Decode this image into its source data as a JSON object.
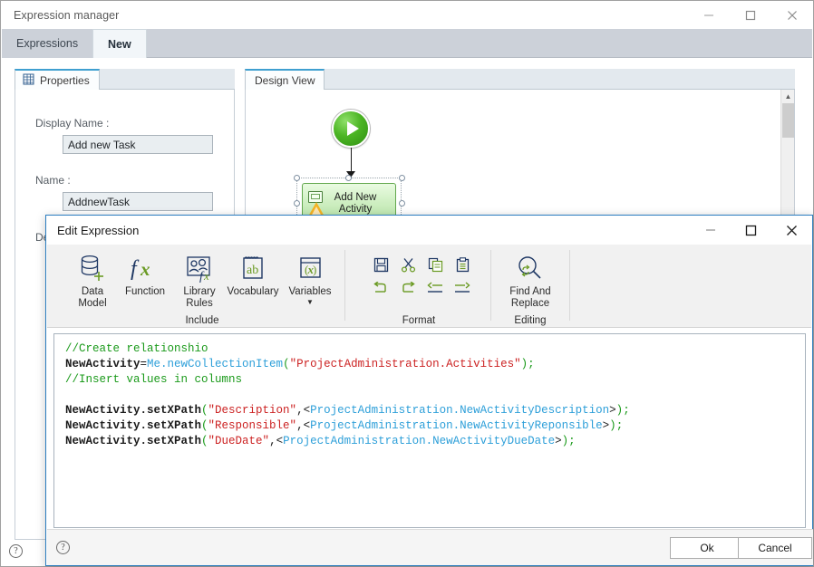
{
  "main_window": {
    "title": "Expression manager",
    "controls": [
      {
        "name": "minimize",
        "glyph": "minimize-icon"
      },
      {
        "name": "maximize",
        "glyph": "maximize-icon"
      },
      {
        "name": "close",
        "glyph": "close-icon"
      }
    ],
    "tabs": [
      {
        "label": "Expressions",
        "active": false
      },
      {
        "label": "New",
        "active": true
      }
    ],
    "help_icon": "help-icon"
  },
  "properties_panel": {
    "tab_label": "Properties",
    "tab_icon": "properties-grid-icon",
    "fields": [
      {
        "label": "Display Name :",
        "value": "Add new Task"
      },
      {
        "label": "Name :",
        "value": "AddnewTask"
      },
      {
        "label": "Des",
        "value": ""
      }
    ]
  },
  "design_panel": {
    "tab_label": "Design View",
    "nodes": [
      {
        "type": "start",
        "icon": "play-start-icon",
        "label": ""
      },
      {
        "type": "activity",
        "label": "Add New\nActivity",
        "icons": [
          "monitor-icon",
          "warning-icon"
        ],
        "selected": true
      }
    ],
    "scrollbar": {
      "up_arrow": "chevron-up-icon"
    }
  },
  "dialog": {
    "title": "Edit Expression",
    "controls": [
      {
        "name": "minimize",
        "glyph": "minimize-icon"
      },
      {
        "name": "maximize",
        "glyph": "maximize-icon"
      },
      {
        "name": "close",
        "glyph": "close-icon"
      }
    ],
    "ribbon": {
      "groups": [
        {
          "title": "Include",
          "buttons": [
            {
              "label": "Data\nModel",
              "icon": "database-add-icon",
              "line1": "Data",
              "line2": "Model",
              "dropdown": false
            },
            {
              "label": "Function",
              "icon": "fx-icon",
              "line1": "Function",
              "line2": "",
              "dropdown": false
            },
            {
              "label": "Library\nRules",
              "icon": "library-rules-icon",
              "line1": "Library",
              "line2": "Rules",
              "dropdown": false
            },
            {
              "label": "Vocabulary",
              "icon": "vocabulary-ab-icon",
              "line1": "Vocabulary",
              "line2": "",
              "dropdown": false
            },
            {
              "label": "Variables",
              "icon": "variables-x-icon",
              "line1": "Variables",
              "line2": "",
              "dropdown": true
            }
          ]
        },
        {
          "title": "Format",
          "buttons": [
            {
              "icon": "save-icon"
            },
            {
              "icon": "cut-icon"
            },
            {
              "icon": "copy-icon"
            },
            {
              "icon": "paste-icon"
            },
            {
              "icon": "undo-icon"
            },
            {
              "icon": "redo-icon"
            },
            {
              "icon": "outdent-icon"
            },
            {
              "icon": "indent-icon"
            }
          ]
        },
        {
          "title": "Editing",
          "buttons": [
            {
              "label": "Find And\nReplace",
              "icon": "find-replace-icon",
              "line1": "Find And",
              "line2": "Replace"
            }
          ]
        }
      ]
    },
    "editor": {
      "lines": [
        [
          {
            "t": "//Create relationshio",
            "c": "c-cmt"
          }
        ],
        [
          {
            "t": "NewActivity",
            "c": "c-id"
          },
          {
            "t": "=",
            "c": "c-op"
          },
          {
            "t": "Me.newCollectionItem",
            "c": "c-me"
          },
          {
            "t": "(",
            "c": "c-pun"
          },
          {
            "t": "\"ProjectAdministration.Activities\"",
            "c": "c-str"
          },
          {
            "t": ")",
            "c": "c-pun"
          },
          {
            "t": ";",
            "c": "c-pun"
          }
        ],
        [
          {
            "t": "//Insert values in columns",
            "c": "c-cmt"
          }
        ],
        [],
        [
          {
            "t": "NewActivity.setXPath",
            "c": "c-id"
          },
          {
            "t": "(",
            "c": "c-pun"
          },
          {
            "t": "\"Description\"",
            "c": "c-str"
          },
          {
            "t": ",<",
            "c": "c-plain"
          },
          {
            "t": "ProjectAdministration.NewActivityDescription",
            "c": "c-xp"
          },
          {
            "t": ">",
            "c": "c-plain"
          },
          {
            "t": ")",
            "c": "c-pun"
          },
          {
            "t": ";",
            "c": "c-pun"
          }
        ],
        [
          {
            "t": "NewActivity.setXPath",
            "c": "c-id"
          },
          {
            "t": "(",
            "c": "c-pun"
          },
          {
            "t": "\"Responsible\"",
            "c": "c-str"
          },
          {
            "t": ",<",
            "c": "c-plain"
          },
          {
            "t": "ProjectAdministration.NewActivityReponsible",
            "c": "c-xp"
          },
          {
            "t": ">",
            "c": "c-plain"
          },
          {
            "t": ")",
            "c": "c-pun"
          },
          {
            "t": ";",
            "c": "c-pun"
          }
        ],
        [
          {
            "t": "NewActivity.setXPath",
            "c": "c-id"
          },
          {
            "t": "(",
            "c": "c-pun"
          },
          {
            "t": "\"DueDate\"",
            "c": "c-str"
          },
          {
            "t": ",<",
            "c": "c-plain"
          },
          {
            "t": "ProjectAdministration.NewActivityDueDate",
            "c": "c-xp"
          },
          {
            "t": ">",
            "c": "c-plain"
          },
          {
            "t": ")",
            "c": "c-pun"
          },
          {
            "t": ";",
            "c": "c-pun"
          }
        ]
      ]
    },
    "footer": {
      "help_icon": "help-icon",
      "ok_label": "Ok",
      "cancel_label": "Cancel"
    }
  },
  "colors": {
    "accent": "#2b7dc0",
    "tabstrip": "#ccd1d9",
    "ribbon_bg": "#f1f1f1",
    "icon_dark": "#1f3864",
    "icon_green": "#6a9a23",
    "comment_green": "#1a9a1a",
    "string_red": "#cc2222",
    "identifier_blue": "#2d9fd9",
    "node_green": "#b7e5a8"
  }
}
